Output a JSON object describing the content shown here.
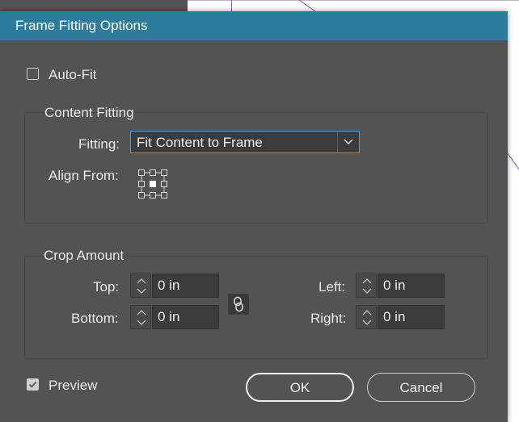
{
  "dialog": {
    "title": "Frame Fitting Options",
    "auto_fit": {
      "label": "Auto-Fit",
      "checked": false
    },
    "content_fitting": {
      "title": "Content Fitting",
      "fitting_label": "Fitting:",
      "fitting_value": "Fit Content to Frame",
      "align_from_label": "Align From:"
    },
    "crop_amount": {
      "title": "Crop Amount",
      "top_label": "Top:",
      "top_value": "0 in",
      "bottom_label": "Bottom:",
      "bottom_value": "0 in",
      "left_label": "Left:",
      "left_value": "0 in",
      "right_label": "Right:",
      "right_value": "0 in"
    },
    "preview": {
      "label": "Preview",
      "checked": true
    },
    "ok_label": "OK",
    "cancel_label": "Cancel"
  },
  "colors": {
    "title_bar": "#2d7c9c",
    "dialog_bg": "#535353",
    "field_bg": "#3b3b3b",
    "focus_border": "#5f9ecb"
  },
  "icons": {
    "align_grid": "reference-point-grid-icon",
    "constrain": "chain-link-icon",
    "dropdown": "chevron-down-icon"
  }
}
